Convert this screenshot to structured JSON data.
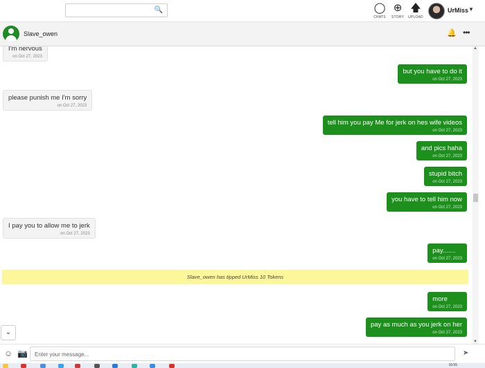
{
  "topbar": {
    "search_placeholder": "",
    "search_icon": "magnifier-icon",
    "nav": [
      {
        "label": "CHATS",
        "icon": "chat-bubble-icon"
      },
      {
        "label": "STORY",
        "icon": "plus-circle-icon"
      },
      {
        "label": "UPLOAD",
        "icon": "upload-icon"
      }
    ],
    "user_name": "UrMiss"
  },
  "chat_header": {
    "contact_name": "Slave_owen"
  },
  "messages": [
    {
      "dir": "in",
      "text": "I'm nervous",
      "time": "on Oct 27, 2023"
    },
    {
      "dir": "out",
      "text": "but you have to do it",
      "time": "on Oct 27, 2023"
    },
    {
      "dir": "in",
      "text": "please punish me I'm sorry",
      "time": "on Oct 27, 2023"
    },
    {
      "dir": "out",
      "text": "tell him you pay Me for jerk on hes wife videos",
      "time": "on Oct 27, 2023"
    },
    {
      "dir": "out",
      "text": "and pics haha",
      "time": "on Oct 27, 2023"
    },
    {
      "dir": "out",
      "text": "stupid bitch",
      "time": "on Oct 27, 2023"
    },
    {
      "dir": "out",
      "text": "you have to tell him now",
      "time": "on Oct 27, 2023"
    },
    {
      "dir": "in",
      "text": "I pay you to allow me to jerk",
      "time": "on Oct 27, 2023"
    },
    {
      "dir": "out",
      "text": "pay.......",
      "time": "on Oct 27, 2023"
    },
    {
      "dir": "out",
      "text": "more",
      "time": "on Oct 27, 2023"
    },
    {
      "dir": "out",
      "text": "pay as much as you jerk on her",
      "time": "on Oct 27, 2023"
    }
  ],
  "tip_notice": "Slave_owen has tipped UrMiss 10 Tokens",
  "composer": {
    "placeholder": "Enter your message...",
    "send_icon": "send-arrow-icon"
  },
  "taskbar": {
    "clock": "16:55"
  }
}
